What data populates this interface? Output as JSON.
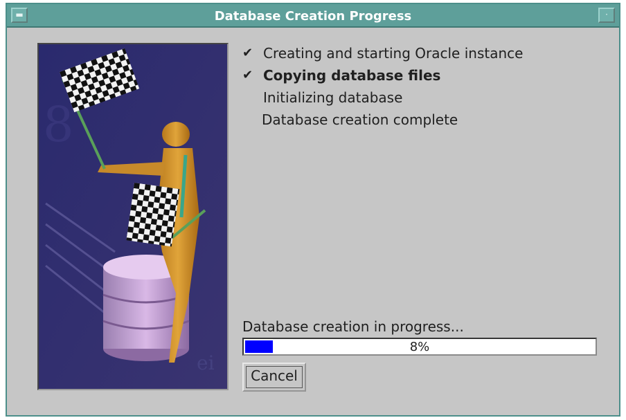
{
  "window": {
    "title": "Database Creation Progress",
    "title_bar_color": "#5e9f9a"
  },
  "steps": [
    {
      "label": "Creating and starting Oracle instance",
      "checked": true,
      "bold": false
    },
    {
      "label": "Copying database files",
      "checked": true,
      "bold": true
    },
    {
      "label": "Initializing database",
      "checked": false,
      "bold": false
    },
    {
      "label": "Database creation complete",
      "checked": false,
      "bold": false
    }
  ],
  "check_glyph": "✔",
  "progress": {
    "label": "Database creation in progress...",
    "percent_text": "8%",
    "value": 0.08,
    "bar_color": "#0000ff"
  },
  "buttons": {
    "cancel_label": "Cancel"
  },
  "icons": {
    "window_menu": "window-menu-icon",
    "window_minimize": "window-minimize-icon",
    "banner_image": "checkered-flags-figure-illustration"
  }
}
